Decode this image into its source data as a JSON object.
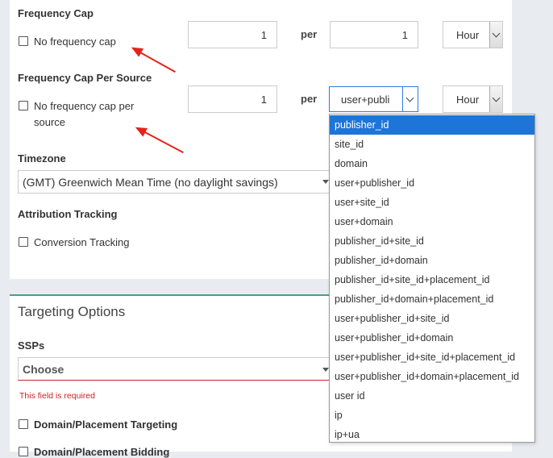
{
  "frequency_cap": {
    "title": "Frequency Cap",
    "no_cap_label": "No frequency cap",
    "count": "1",
    "per_label": "per",
    "per_value": "1",
    "unit": "Hour"
  },
  "frequency_cap_source": {
    "title": "Frequency Cap Per Source",
    "no_cap_label_line1": "No frequency cap per",
    "no_cap_label_line2": "source",
    "count": "1",
    "per_label": "per",
    "source_selected": "user+publi",
    "unit": "Hour",
    "options": [
      "publisher_id",
      "site_id",
      "domain",
      "user+publisher_id",
      "user+site_id",
      "user+domain",
      "publisher_id+site_id",
      "publisher_id+domain",
      "publisher_id+site_id+placement_id",
      "publisher_id+domain+placement_id",
      "user+publisher_id+site_id",
      "user+publisher_id+domain",
      "user+publisher_id+site_id+placement_id",
      "user+publisher_id+domain+placement_id",
      "user id",
      "ip",
      "ip+ua"
    ],
    "highlighted_option_index": 0
  },
  "timezone": {
    "title": "Timezone",
    "value": "(GMT) Greenwich Mean Time (no daylight savings)"
  },
  "attribution": {
    "title": "Attribution Tracking",
    "conversion_label": "Conversion Tracking"
  },
  "targeting": {
    "title": "Targeting Options",
    "ssps_label": "SSPs",
    "ssps_placeholder": "Choose",
    "error": "This field is required",
    "domain_targeting": "Domain/Placement Targeting",
    "domain_bidding": "Domain/Placement Bidding"
  },
  "colors": {
    "accent_green": "#3fa48a",
    "selected_blue": "#1e75d7",
    "error_red": "#cc2222",
    "arrow_red": "#e4231b"
  }
}
